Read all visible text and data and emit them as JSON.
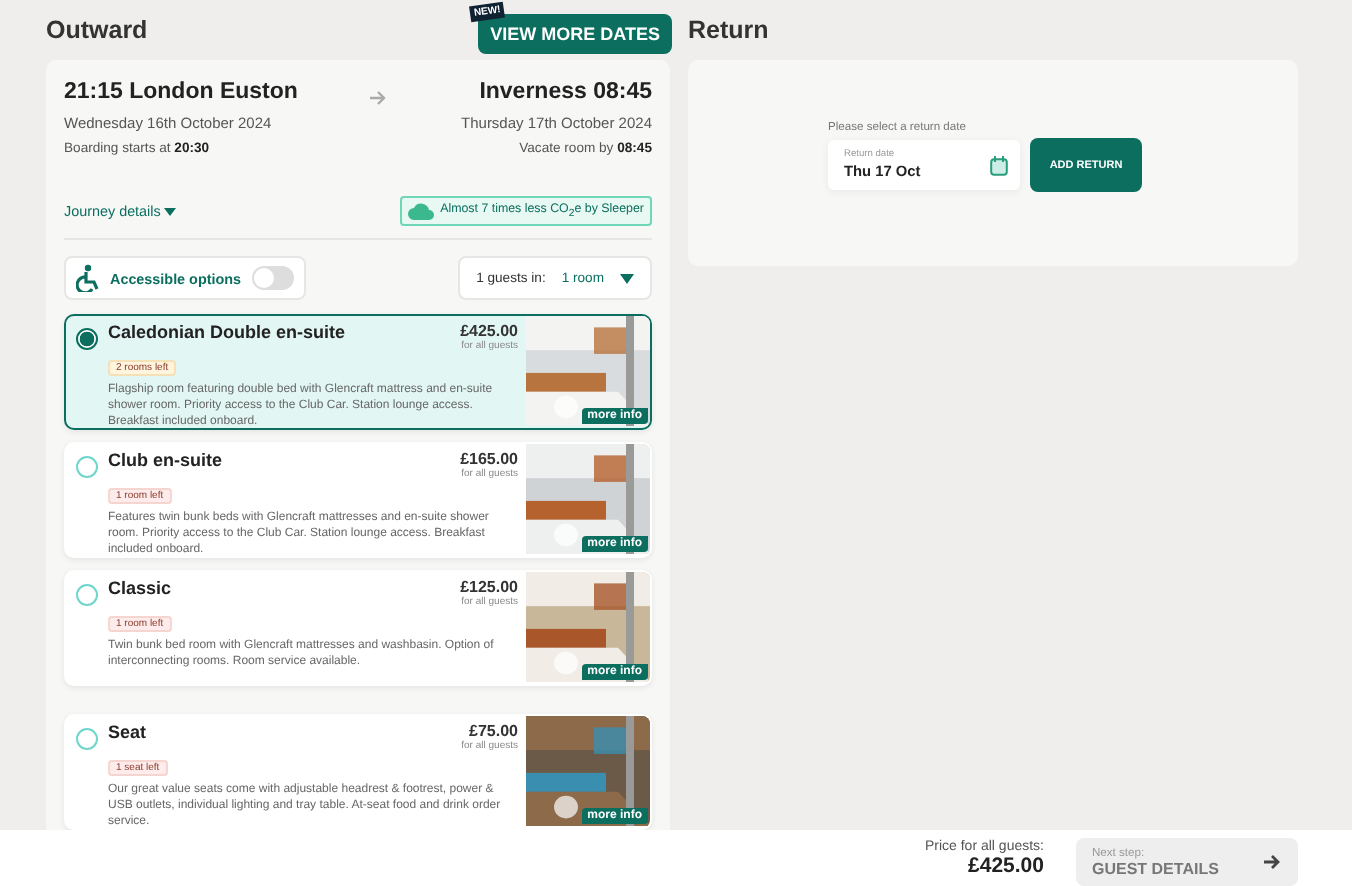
{
  "outward": {
    "title": "Outward",
    "new_badge": "NEW!",
    "view_more": "VIEW MORE DATES",
    "departure": {
      "heading": "21:15 London Euston",
      "date": "Wednesday 16th October 2024",
      "note": "Boarding starts at **20:30**"
    },
    "arrival": {
      "heading": "Inverness 08:45",
      "date": "Thursday 17th October 2024",
      "note": "Vacate room by **08:45**"
    },
    "journey_details": "Journey details",
    "co2": "Almost 7 times less CO$_{2}$e by Sleeper",
    "accessible": {
      "label": "Accessible options",
      "on": false
    },
    "guests": {
      "label": "1 guests in:",
      "value": "1 room"
    },
    "rooms": [
      {
        "name": "Caledonian Double en-suite",
        "availability": "2 rooms left",
        "price": "£425.00",
        "price_note": "for all guests",
        "description": "Flagship room featuring double bed with Glencraft mattress and en-suite shower room. Priority access to the Club Car. Station lounge access. Breakfast included onboard.",
        "more_info": "more info",
        "selected": true
      },
      {
        "name": "Club en-suite",
        "availability": "1 room left",
        "price": "£165.00",
        "price_note": "for all guests",
        "description": "Features twin bunk beds with Glencraft mattresses and en-suite shower room. Priority access to the Club Car. Station lounge access. Breakfast included onboard.",
        "more_info": "more info",
        "selected": false
      },
      {
        "name": "Classic",
        "availability": "1 room left",
        "price": "£125.00",
        "price_note": "for all guests",
        "description": "Twin bunk bed room with Glencraft mattresses and washbasin. Option of interconnecting rooms. Room service available.",
        "more_info": "more info",
        "selected": false
      },
      {
        "name": "Seat",
        "availability": "1 seat left",
        "price": "£75.00",
        "price_note": "for all guests",
        "description": "Our great value seats come with adjustable headrest & footrest, power & USB outlets, individual lighting and tray table. At-seat food and drink order service.",
        "more_info": "more info",
        "selected": false
      }
    ]
  },
  "return": {
    "title": "Return",
    "prompt": "Please select a return date",
    "field_label": "Return date",
    "field_value": "Thu 17 Oct",
    "button": "ADD RETURN"
  },
  "footer": {
    "price_label": "Price for all guests:",
    "price": "£425.00",
    "next_label": "Next step:",
    "next_value": "GUEST DETAILS"
  }
}
